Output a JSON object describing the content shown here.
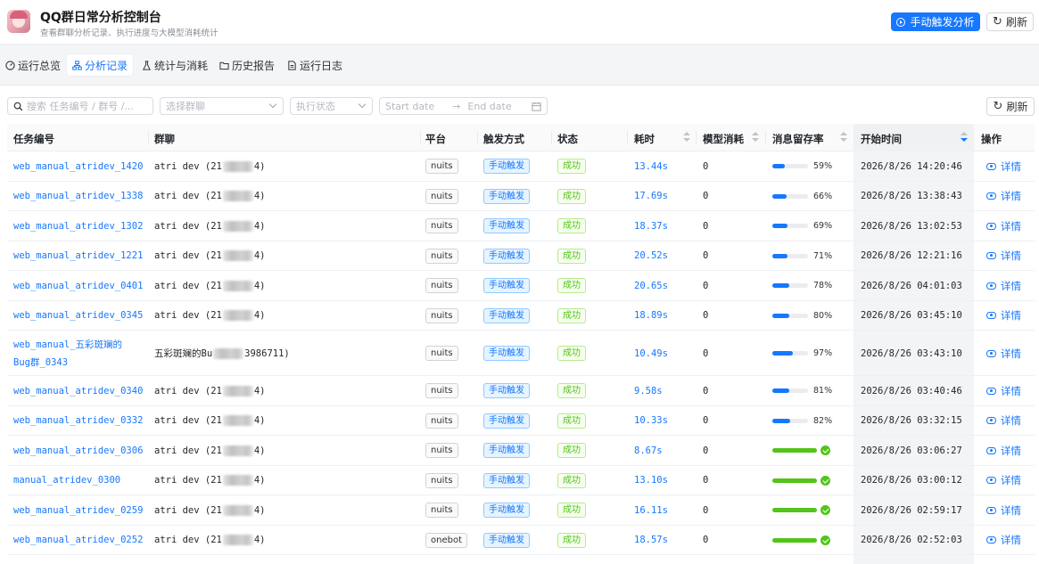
{
  "header": {
    "title": "QQ群日常分析控制台",
    "subtitle": "查看群聊分析记录、执行进度与大模型消耗统计",
    "trigger_button": "手动触发分析",
    "refresh_button": "刷新"
  },
  "tabs": [
    {
      "label": "运行总览",
      "icon": "dashboard-icon",
      "active": false
    },
    {
      "label": "分析记录",
      "icon": "cluster-icon",
      "active": true
    },
    {
      "label": "统计与消耗",
      "icon": "flask-icon",
      "active": false
    },
    {
      "label": "历史报告",
      "icon": "folder-icon",
      "active": false
    },
    {
      "label": "运行日志",
      "icon": "file-text-icon",
      "active": false
    }
  ],
  "filters": {
    "search_placeholder": "搜索 任务编号 / 群号 /...",
    "group_placeholder": "选择群聊",
    "status_placeholder": "执行状态",
    "start_date_placeholder": "Start date",
    "end_date_placeholder": "End date",
    "refresh_button": "刷新"
  },
  "table": {
    "columns": [
      "任务编号",
      "群聊",
      "平台",
      "触发方式",
      "状态",
      "耗时",
      "模型消耗",
      "消息留存率",
      "开始时间",
      "操作"
    ],
    "action_label": "详情",
    "rows": [
      {
        "id": "web_manual_atridev_1420",
        "group_prefix": "atri dev (21",
        "group_suffix": "4)",
        "platform": "nuits",
        "trigger": "手动触发",
        "status": "成功",
        "duration": "13.44s",
        "cost": "0",
        "retention": 59,
        "retention_label": "59%",
        "start": "2026/8/26 14:20:46"
      },
      {
        "id": "web_manual_atridev_1338",
        "group_prefix": "atri dev (21",
        "group_suffix": "4)",
        "platform": "nuits",
        "trigger": "手动触发",
        "status": "成功",
        "duration": "17.69s",
        "cost": "0",
        "retention": 66,
        "retention_label": "66%",
        "start": "2026/8/26 13:38:43"
      },
      {
        "id": "web_manual_atridev_1302",
        "group_prefix": "atri dev (21",
        "group_suffix": "4)",
        "platform": "nuits",
        "trigger": "手动触发",
        "status": "成功",
        "duration": "18.37s",
        "cost": "0",
        "retention": 69,
        "retention_label": "69%",
        "start": "2026/8/26 13:02:53"
      },
      {
        "id": "web_manual_atridev_1221",
        "group_prefix": "atri dev (21",
        "group_suffix": "4)",
        "platform": "nuits",
        "trigger": "手动触发",
        "status": "成功",
        "duration": "20.52s",
        "cost": "0",
        "retention": 71,
        "retention_label": "71%",
        "start": "2026/8/26 12:21:16"
      },
      {
        "id": "web_manual_atridev_0401",
        "group_prefix": "atri dev (21",
        "group_suffix": "4)",
        "platform": "nuits",
        "trigger": "手动触发",
        "status": "成功",
        "duration": "20.65s",
        "cost": "0",
        "retention": 78,
        "retention_label": "78%",
        "start": "2026/8/26 04:01:03"
      },
      {
        "id": "web_manual_atridev_0345",
        "group_prefix": "atri dev (21",
        "group_suffix": "4)",
        "platform": "nuits",
        "trigger": "手动触发",
        "status": "成功",
        "duration": "18.89s",
        "cost": "0",
        "retention": 80,
        "retention_label": "80%",
        "start": "2026/8/26 03:45:10"
      },
      {
        "id": "web_manual_五彩斑斓的",
        "id_line2": "Bug群_0343",
        "group_prefix": "五彩斑斓的Bu",
        "group_suffix": "3986711)",
        "platform": "nuits",
        "trigger": "手动触发",
        "status": "成功",
        "duration": "10.49s",
        "cost": "0",
        "retention": 97,
        "retention_label": "97%",
        "start": "2026/8/26 03:43:10",
        "tall": true
      },
      {
        "id": "web_manual_atridev_0340",
        "group_prefix": "atri dev (21",
        "group_suffix": "4)",
        "platform": "nuits",
        "trigger": "手动触发",
        "status": "成功",
        "duration": "9.58s",
        "cost": "0",
        "retention": 81,
        "retention_label": "81%",
        "start": "2026/8/26 03:40:46"
      },
      {
        "id": "web_manual_atridev_0332",
        "group_prefix": "atri dev (21",
        "group_suffix": "4)",
        "platform": "nuits",
        "trigger": "手动触发",
        "status": "成功",
        "duration": "10.33s",
        "cost": "0",
        "retention": 82,
        "retention_label": "82%",
        "start": "2026/8/26 03:32:15"
      },
      {
        "id": "web_manual_atridev_0306",
        "group_prefix": "atri dev (21",
        "group_suffix": "4)",
        "platform": "nuits",
        "trigger": "手动触发",
        "status": "成功",
        "duration": "8.67s",
        "cost": "0",
        "retention": 100,
        "retention_label": "",
        "start": "2026/8/26 03:06:27"
      },
      {
        "id": "manual_atridev_0300",
        "group_prefix": "atri dev (21",
        "group_suffix": "4)",
        "platform": "nuits",
        "trigger": "手动触发",
        "status": "成功",
        "duration": "13.10s",
        "cost": "0",
        "retention": 100,
        "retention_label": "",
        "start": "2026/8/26 03:00:12"
      },
      {
        "id": "web_manual_atridev_0259",
        "group_prefix": "atri dev (21",
        "group_suffix": "4)",
        "platform": "nuits",
        "trigger": "手动触发",
        "status": "成功",
        "duration": "16.11s",
        "cost": "0",
        "retention": 100,
        "retention_label": "",
        "start": "2026/8/26 02:59:17"
      },
      {
        "id": "web_manual_atridev_0252",
        "group_prefix": "atri dev (21",
        "group_suffix": "4)",
        "platform": "onebot",
        "trigger": "手动触发",
        "status": "成功",
        "duration": "18.57s",
        "cost": "0",
        "retention": 100,
        "retention_label": "",
        "start": "2026/8/26 02:52:03"
      }
    ]
  }
}
